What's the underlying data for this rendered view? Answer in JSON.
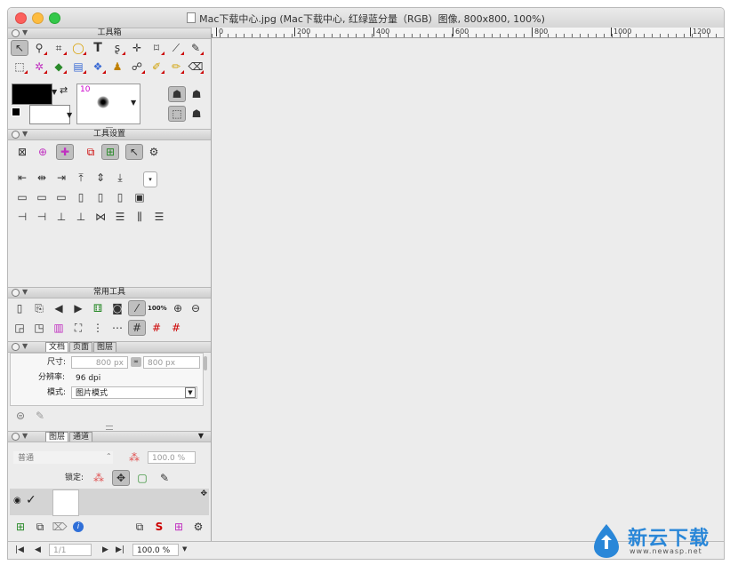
{
  "window": {
    "title": "Mac下载中心.jpg (Mac下载中心, 红绿蓝分量（RGB）图像, 800x800, 100%)"
  },
  "ruler": {
    "labels": [
      "0",
      "200",
      "400",
      "600",
      "800",
      "1000",
      "1200"
    ]
  },
  "toolbox": {
    "title": "工具箱",
    "brush_size": "10"
  },
  "tool_settings": {
    "title": "工具设置"
  },
  "common_tools": {
    "title": "常用工具",
    "zoom_label": "100%"
  },
  "document_panel": {
    "tabs": [
      "文档",
      "页面",
      "图层"
    ],
    "size_label": "尺寸:",
    "width_value": "800 px",
    "height_value": "800 px",
    "resolution_label": "分辨率:",
    "resolution_value": "96 dpi",
    "mode_label": "模式:",
    "mode_value": "图片模式"
  },
  "layers_panel": {
    "tabs": [
      "图层",
      "通道"
    ],
    "blend_mode": "普通",
    "opacity": "100.0 %",
    "lock_label": "锁定:"
  },
  "status_bar": {
    "page_value": "1/1",
    "zoom_value": "100.0 %"
  },
  "watermark": {
    "text": "新云下载",
    "url": "www.newasp.net"
  },
  "colors": {
    "accent_red": "#cc0000",
    "selection": "#bfbfbf",
    "brush_size": "#cc00cc"
  }
}
